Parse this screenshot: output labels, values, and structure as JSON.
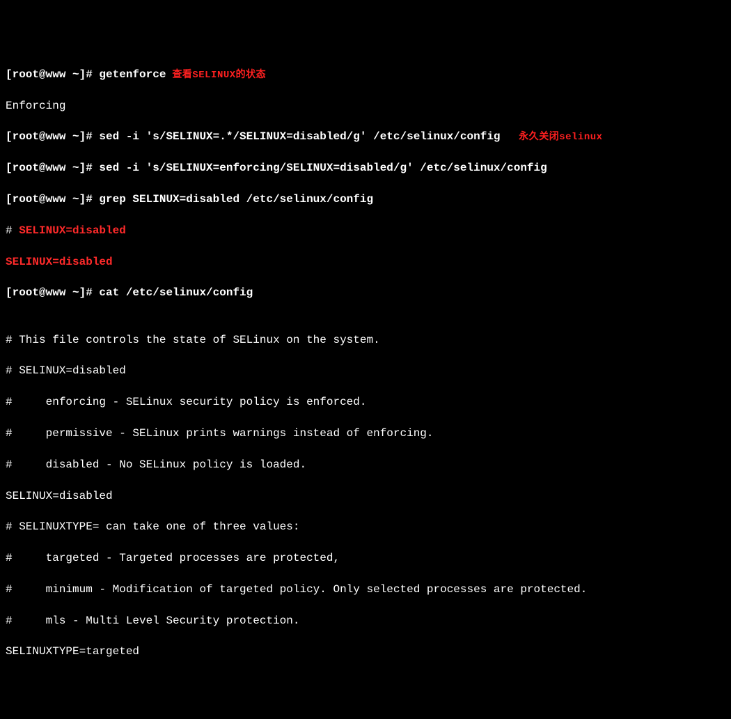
{
  "prompt": "[root@www ~]# ",
  "cmd_getenforce": "getenforce",
  "anno_status": " 查看SELINUX的状态",
  "out_enforcing": "Enforcing",
  "cmd_sed1": "sed -i 's/SELINUX=.*/SELINUX=disabled/g' /etc/selinux/config",
  "anno_disable": "   永久关闭selinux",
  "cmd_sed2": "sed -i 's/SELINUX=enforcing/SELINUX=disabled/g' /etc/selinux/config",
  "cmd_grep": "grep SELINUX=disabled /etc/selinux/config",
  "grep_line1_prefix": "# ",
  "grep_match": "SELINUX=disabled",
  "cmd_cat": "cat /etc/selinux/config",
  "blank": "",
  "file_l1": "# This file controls the state of SELinux on the system.",
  "file_l2": "# SELINUX=disabled",
  "file_l3": "#     enforcing - SELinux security policy is enforced.",
  "file_l4": "#     permissive - SELinux prints warnings instead of enforcing.",
  "file_l5": "#     disabled - No SELinux policy is loaded.",
  "file_l6": "SELINUX=disabled",
  "file_l7": "# SELINUXTYPE= can take one of three values:",
  "file_l8": "#     targeted - Targeted processes are protected,",
  "file_l9": "#     minimum - Modification of targeted policy. Only selected processes are protected.",
  "file_l10": "#     mls - Multi Level Security protection.",
  "file_l11": "SELINUXTYPE=targeted"
}
